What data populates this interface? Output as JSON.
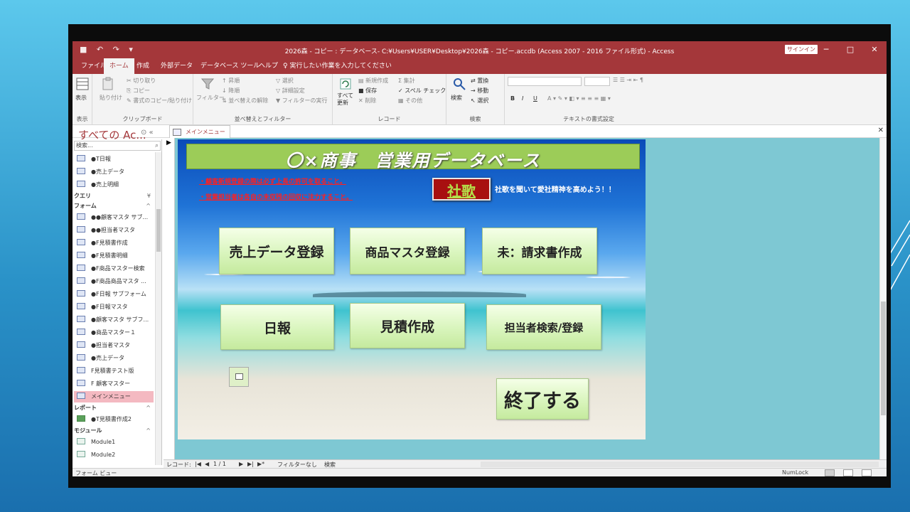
{
  "window": {
    "title": "2026森 - コピー : データベース- C:¥Users¥USER¥Desktop¥2026森 - コピー.accdb (Access 2007 - 2016 ファイル形式) - Access",
    "signin_label": "サインイン",
    "minimize": "─",
    "maximize": "□",
    "close": "✕"
  },
  "ribbon_tabs": [
    "ファイル",
    "ホーム",
    "作成",
    "外部データ",
    "データベース ツール",
    "ヘルプ"
  ],
  "tell_me": "実行したい作業を入力してください",
  "ribbon": {
    "view_label": "表示",
    "view_group": "表示",
    "paste_label": "貼り付け",
    "cut_label": "切り取り",
    "copy_label": "コピー",
    "format_painter_label": "書式のコピー/貼り付け",
    "clipboard_group": "クリップボード",
    "filter_label": "フィルター",
    "ascending_label": "昇順",
    "descending_label": "降順",
    "remove_sort_label": "並べ替えの解除",
    "selection_label": "選択",
    "advanced_label": "詳細設定",
    "toggle_filter_label": "フィルターの実行",
    "sort_filter_group": "並べ替えとフィルター",
    "refresh_all_label": "すべて\n更新",
    "new_label": "新規作成",
    "save_label": "保存",
    "delete_label": "削除",
    "totals_label": "集計",
    "spelling_label": "スペル チェック",
    "more_label": "その他",
    "records_group": "レコード",
    "find_label": "検索",
    "replace_label": "置換",
    "goto_label": "移動",
    "select_label": "選択",
    "find_group": "検索",
    "bold": "B",
    "italic": "I",
    "underline": "U",
    "text_format_group": "テキストの書式設定"
  },
  "nav_pane": {
    "title": "すべての Ac...",
    "search_placeholder": "検索...",
    "items_top": [
      "●T日報",
      "●売上データ",
      "●売上明細"
    ],
    "group_query": "クエリ",
    "group_form": "フォーム",
    "forms": [
      "●●顧客マスタ サブ...",
      "●●担当者マスタ",
      "●F見積書作成",
      "●F見積書明細",
      "●F商品マスター検索",
      "●F商品商品マスタ ...",
      "●F日報 サブフォーム",
      "●F日報マスタ",
      "●顧客マスタ サブフ...",
      "●商品マスター１",
      "●担当者マスタ",
      "●売上データ",
      "F見積書テスト版",
      "F 顧客マスター",
      "メインメニュー"
    ],
    "group_report": "レポート",
    "reports": [
      "●T見積書作成2"
    ],
    "group_module": "モジュール",
    "modules": [
      "Module1",
      "Module2"
    ]
  },
  "doc_tab": "メインメニュー",
  "form": {
    "header": "〇×商事　営業用データベース",
    "notice1": "・顧客新規登録の際は必ず上長の許可を取ること。",
    "notice2": "・営業担当者は各自の未収残の回収に注力すること。",
    "shaka_label": "社歌",
    "shaka_message": "社歌を聞いて愛社精神を高めよう！！",
    "buttons": {
      "sales_entry": "売上データ登録",
      "product_master": "商品マスタ登録",
      "invoice": "未：請求書作成",
      "daily_report": "日報",
      "estimate": "見積作成",
      "staff_search": "担当者検索/登録",
      "exit": "終了する"
    }
  },
  "record_nav": {
    "label": "レコード:",
    "first": "|◀",
    "prev": "◀",
    "position": "1 / 1",
    "next": "▶",
    "last": "▶|",
    "new": "▶*",
    "filter": "フィルターなし",
    "search": "検索"
  },
  "status": {
    "view": "フォーム ビュー",
    "numlock": "NumLock"
  }
}
